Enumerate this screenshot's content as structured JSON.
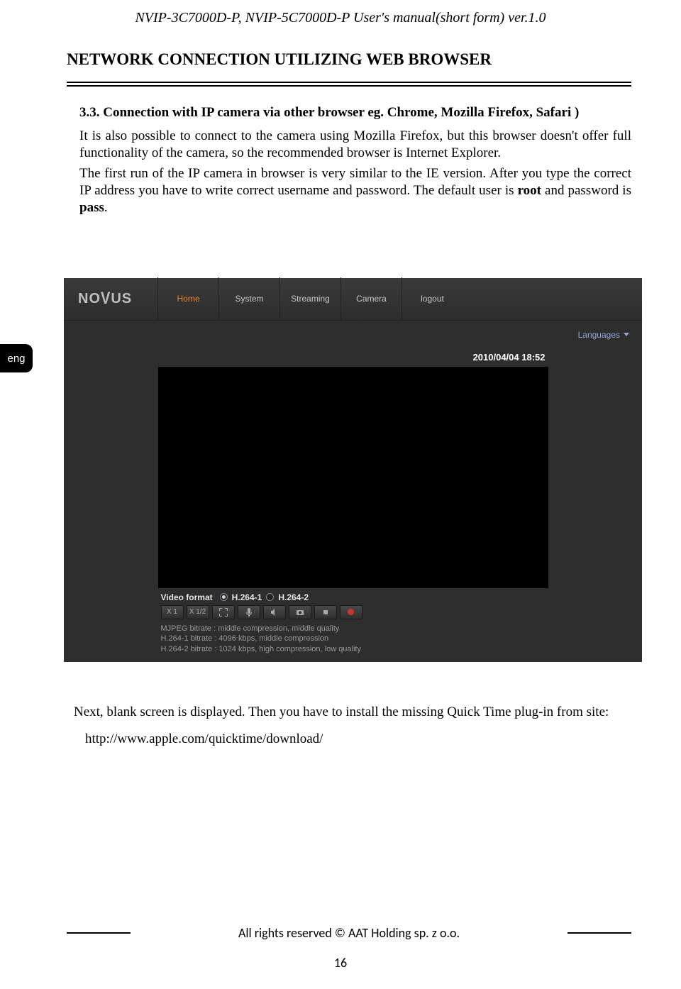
{
  "header": "NVIP-3C7000D-P, NVIP-5C7000D-P User's manual(short form) ver.1.0",
  "section_title": "NETWORK CONNECTION UTILIZING WEB BROWSER",
  "sub_heading": "3.3. Connection with IP camera via other browser eg. Chrome, Mozilla Firefox, Safari )",
  "para1": "It is also possible to connect to the camera using Mozilla Firefox, but this browser doesn't offer full functionality of the camera, so the recommended browser is Internet Explorer.",
  "para2_a": "The first run of the IP camera in browser is very similar to  the IE version. After you type the correct IP address you have to write correct username and password. The default user is ",
  "para2_root": "root",
  "para2_b": " and password is ",
  "para2_pass": "pass",
  "para2_c": ".",
  "lang_tab": "eng",
  "ui": {
    "logo_a": "NO",
    "logo_b": "US",
    "nav": {
      "home": "Home",
      "system": "System",
      "streaming": "Streaming",
      "camera": "Camera",
      "logout": "logout"
    },
    "languages": "Languages",
    "timestamp": "2010/04/04 18:52",
    "video_format_label": "Video format",
    "radio1": "H.264-1",
    "radio2": "H.264-2",
    "zoom1": "X 1",
    "zoom2": "X 1/2",
    "info1": "MJPEG bitrate : middle compression, middle quality",
    "info2": "H.264-1 bitrate : 4096 kbps, middle compression",
    "info3": "H.264-2 bitrate : 1024 kbps, high compression, low quality"
  },
  "next_para": "Next, blank screen is displayed. Then you have to install the missing Quick Time plug-in from site:",
  "url": "http://www.apple.com/quicktime/download/",
  "footer": "All rights reserved © AAT Holding sp. z o.o.",
  "page_number": "16"
}
